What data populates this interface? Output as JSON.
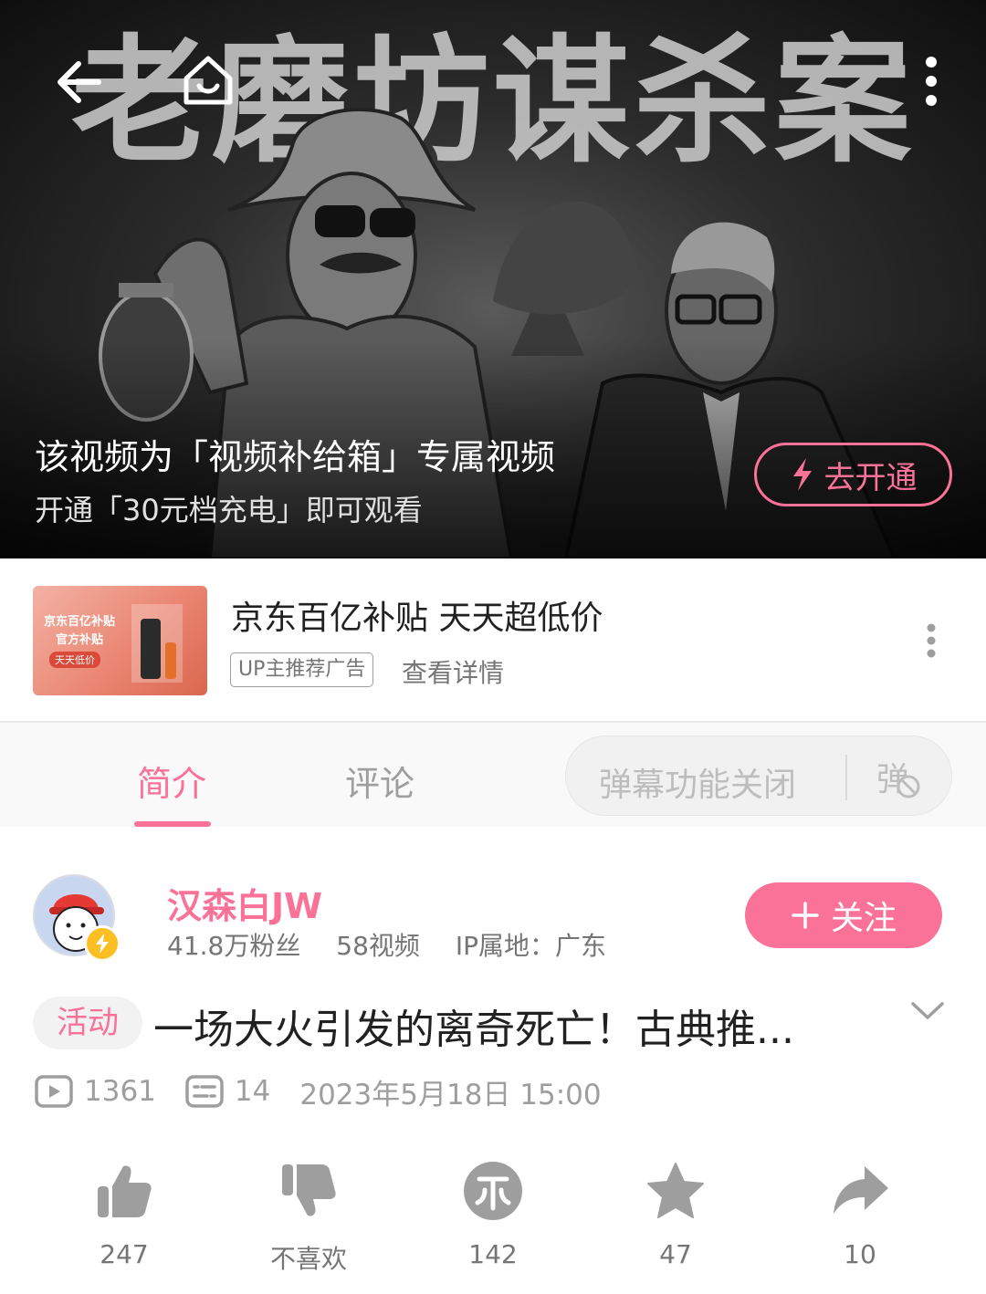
{
  "cover": {
    "big_title": "老磨坊谋杀案",
    "lock_title": "该视频为「视频补给箱」专属视频",
    "lock_sub": "开通「30元档充电」即可观看",
    "open_button": "去开通"
  },
  "ad": {
    "thumb_text": "京东百亿补贴 官方补贴",
    "thumb_tag": "天天低价",
    "title": "京东百亿补贴 天天超低价",
    "badge": "UP主推荐广告",
    "detail": "查看详情"
  },
  "tabs": {
    "intro": "简介",
    "comments": "评论",
    "danmaku": "弹幕功能关闭",
    "danmaku_icon": "弹"
  },
  "uploader": {
    "name": "汉森白JW",
    "fans": "41.8万粉丝",
    "videos": "58视频",
    "ip": "IP属地：广东",
    "follow": "关注"
  },
  "video": {
    "activity_tag": "活动",
    "title": "一场大火引发的离奇死亡！古典推...",
    "views": "1361",
    "danmaku_count": "14",
    "date": "2023年5月18日 15:00"
  },
  "actions": {
    "like": "247",
    "dislike": "不喜欢",
    "coin": "142",
    "favorite": "47",
    "share": "10"
  },
  "colors": {
    "accent": "#fb7299",
    "muted": "#9e9e9e"
  }
}
